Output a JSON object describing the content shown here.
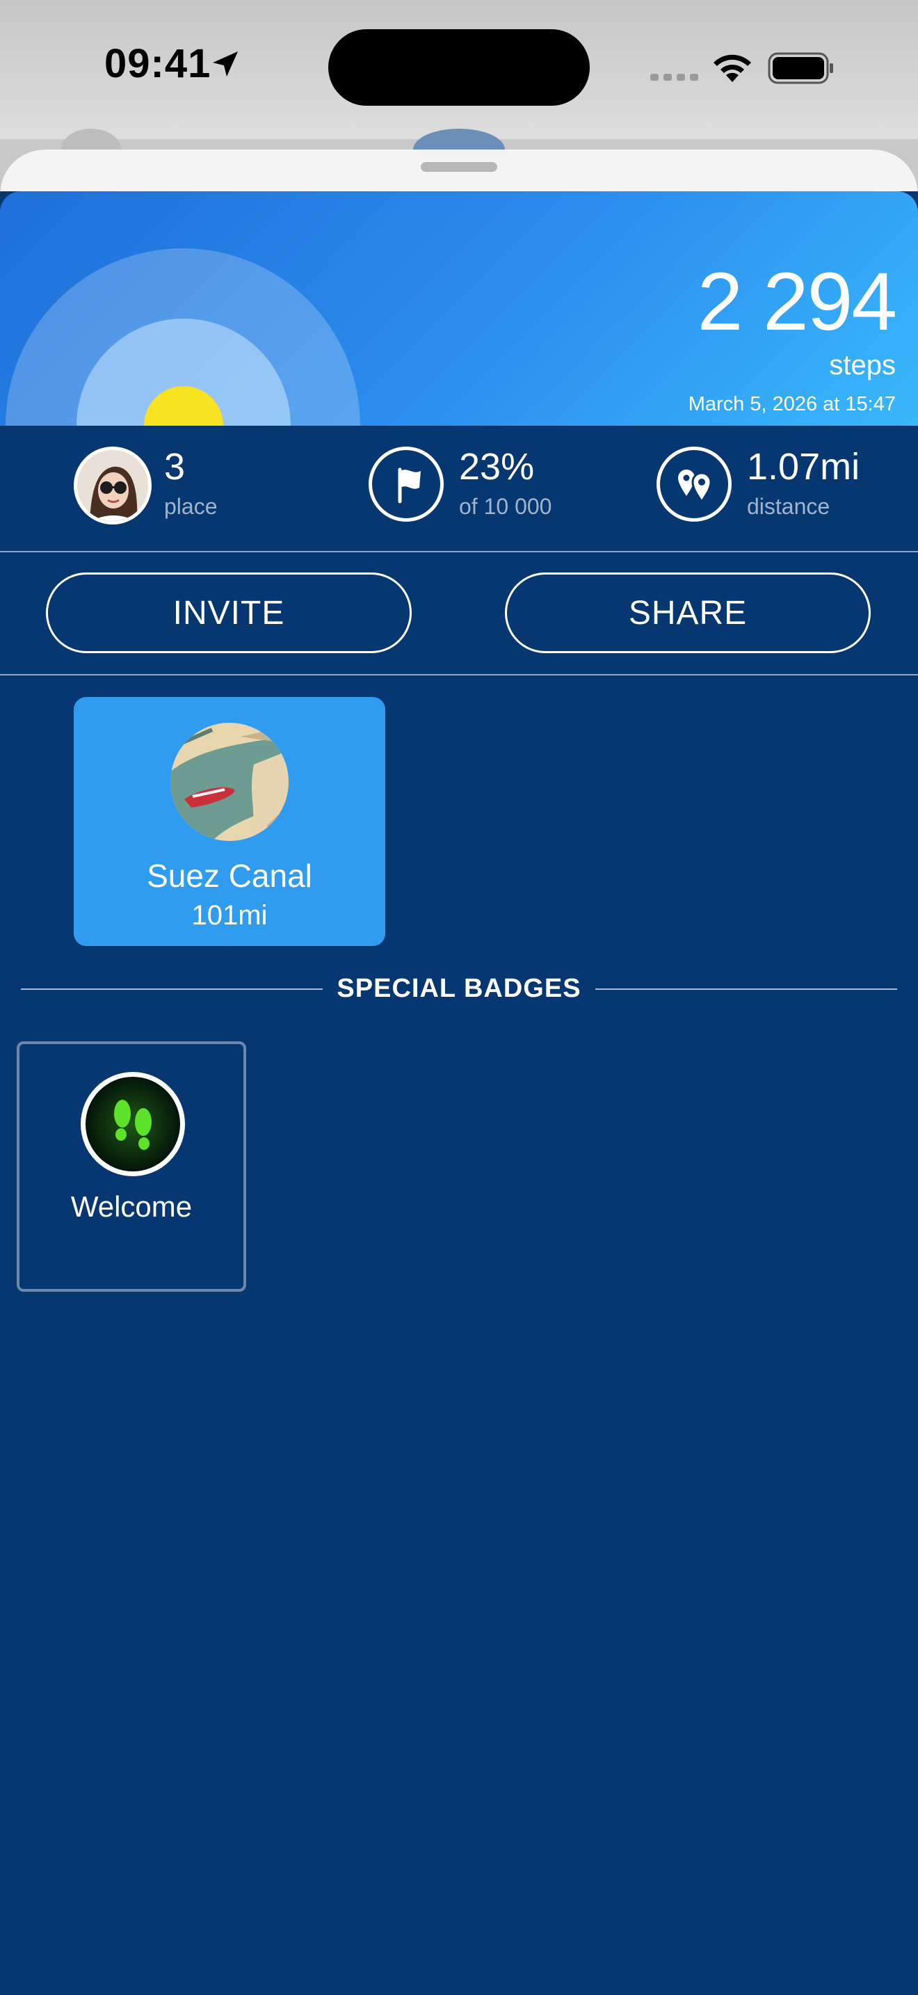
{
  "status_bar": {
    "time": "09:41",
    "icons": [
      "location-arrow-icon",
      "cellular-signal-icon",
      "wifi-icon",
      "battery-icon"
    ]
  },
  "hero": {
    "steps_count": "2 294",
    "steps_unit": "steps",
    "timestamp": "March 5, 2026 at 15:47",
    "colors": {
      "gradient_start": "#1f6fd9",
      "gradient_end": "#39b8fb",
      "sun": "#f8e31e"
    }
  },
  "stats": {
    "place": {
      "value": "3",
      "label": "place"
    },
    "goal": {
      "value": "23%",
      "label": "of 10 000",
      "icon": "flag-icon"
    },
    "distance": {
      "value": "1.07mi",
      "label": "distance",
      "icon": "map-pins-icon"
    }
  },
  "actions": {
    "invite_label": "INVITE",
    "share_label": "SHARE"
  },
  "route": {
    "name": "Suez Canal",
    "distance": "101mi"
  },
  "special_badges": {
    "title": "SPECIAL BADGES",
    "items": [
      {
        "name": "Welcome",
        "icon": "footprints-icon"
      }
    ]
  },
  "colors": {
    "background": "#073770",
    "card": "#2f9cf0",
    "accent_green": "#5fe22a"
  }
}
